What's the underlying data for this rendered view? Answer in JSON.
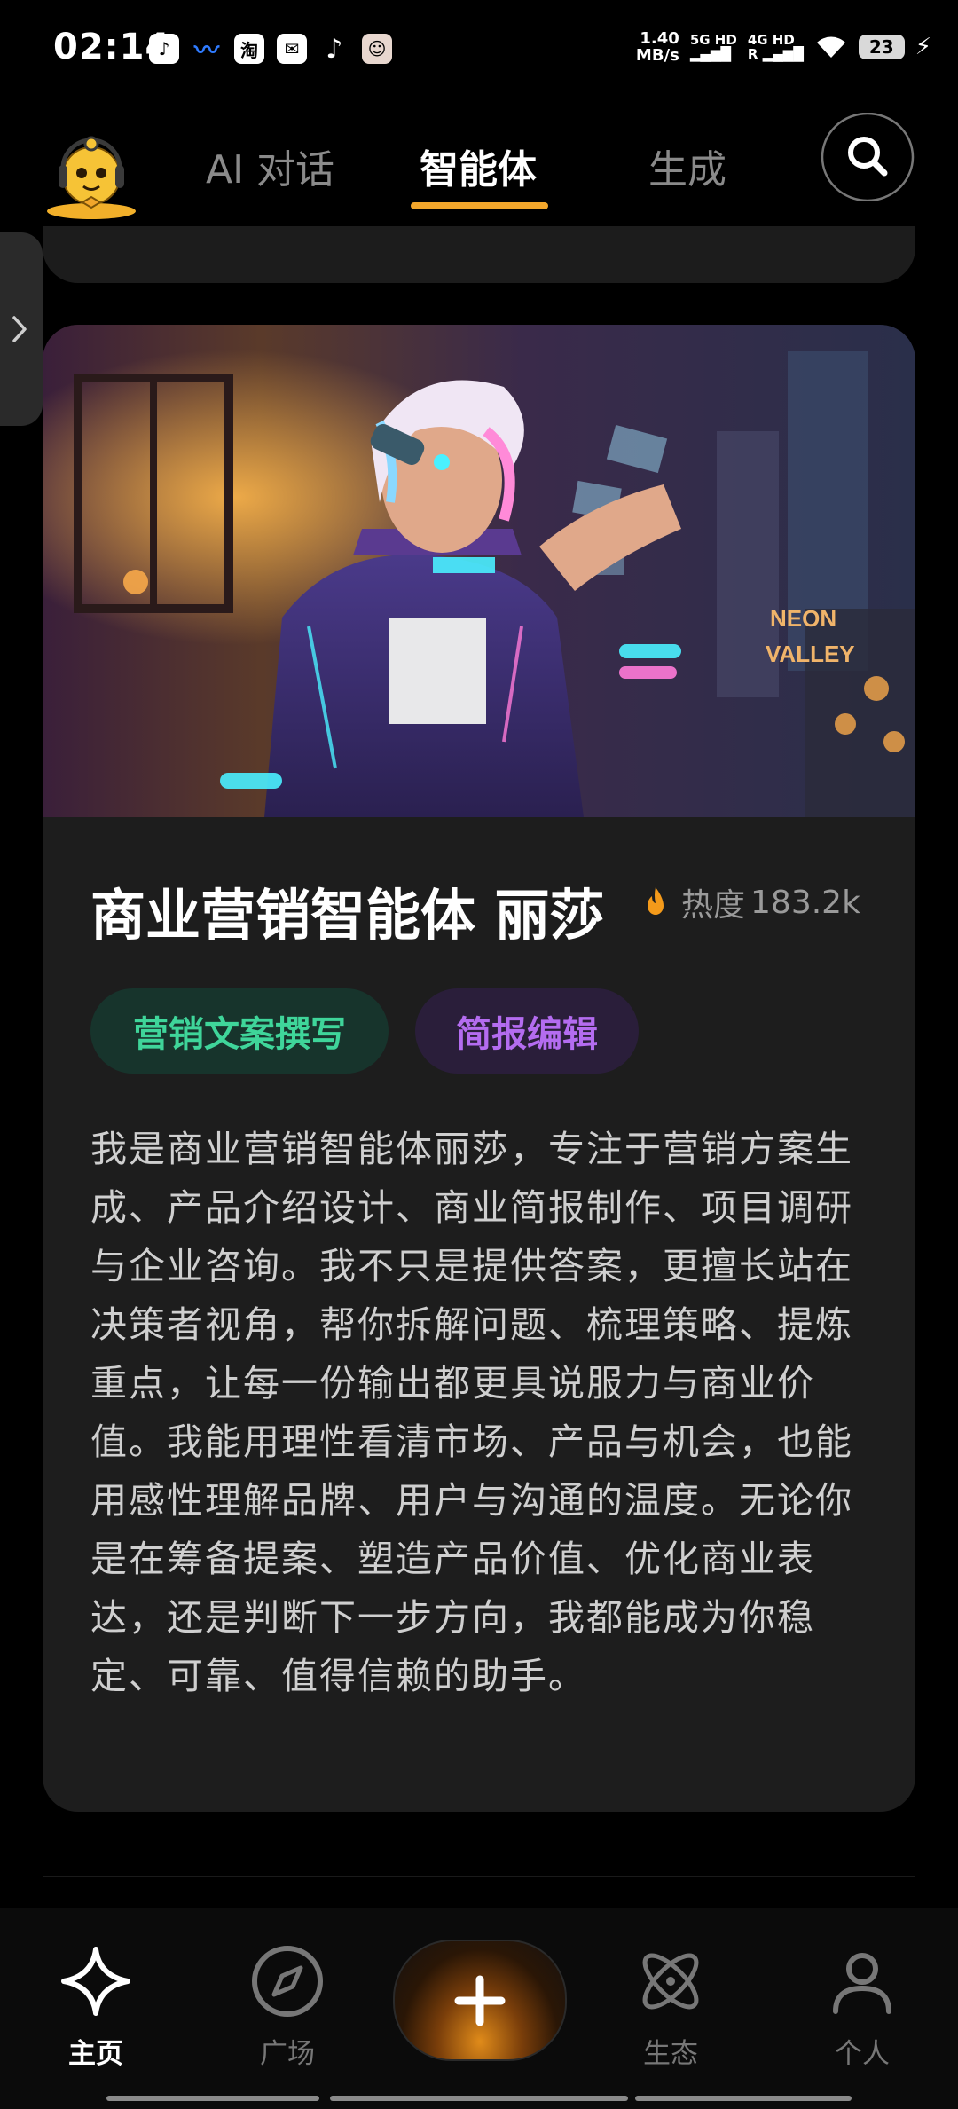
{
  "status_bar": {
    "time": "02:14",
    "net_speed_value": "1.40",
    "net_speed_unit": "MB/s",
    "sim1_label": "5G HD",
    "sim2_label": "4G HD",
    "battery": "23",
    "app_icons": [
      "taobao-icon",
      "tiktok-icon"
    ],
    "taobao_glyph": "淘"
  },
  "top_nav": {
    "tabs": [
      {
        "label": "AI 对话"
      },
      {
        "label": "智能体"
      },
      {
        "label": "生成"
      }
    ],
    "active_tab": "智能体"
  },
  "agent_card": {
    "title": "商业营销智能体 丽莎",
    "heat_label": "热度",
    "heat_value": "183.2k",
    "tags": [
      {
        "label": "营销文案撰写",
        "color": "#3fd59a"
      },
      {
        "label": "简报编辑",
        "color": "#b46cf0"
      }
    ],
    "description": "我是商业营销智能体丽莎，专注于营销方案生成、产品介绍设计、商业简报制作、项目调研与企业咨询。我不只是提供答案，更擅长站在决策者视角，帮你拆解问题、梳理策略、提炼重点，让每一份输出都更具说服力与商业价值。我能用理性看清市场、产品与机会，也能用感性理解品牌、用户与沟通的温度。无论你是在筹备提案、塑造产品价值、优化商业表达，还是判断下一步方向，我都能成为你稳定、可靠、值得信赖的助手。"
  },
  "bottom_nav": {
    "items": [
      {
        "label": "主页",
        "icon": "sparkle-star-icon"
      },
      {
        "label": "广场",
        "icon": "compass-icon"
      },
      {
        "label": "",
        "icon": "plus-icon"
      },
      {
        "label": "生态",
        "icon": "atom-icon"
      },
      {
        "label": "个人",
        "icon": "person-icon"
      }
    ],
    "active": "主页"
  },
  "colors": {
    "accent": "#f2a62b",
    "background": "#000000",
    "card": "#1d1d1d"
  }
}
